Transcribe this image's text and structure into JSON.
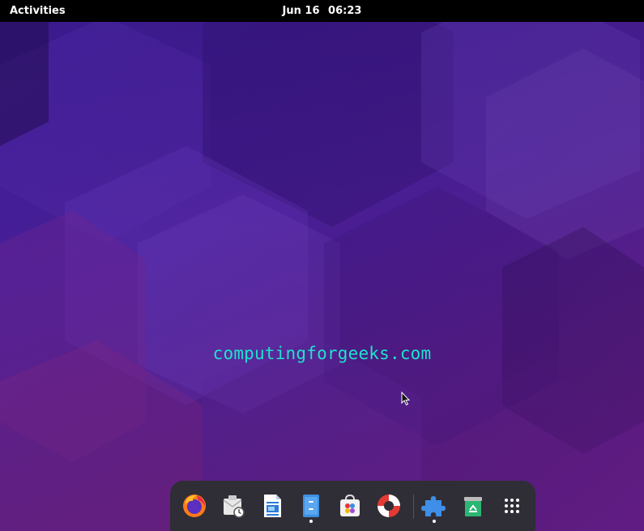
{
  "topbar": {
    "activities_label": "Activities",
    "date": "Jun 16",
    "time": "06:23"
  },
  "desktop": {
    "watermark": "computingforgeeks.com"
  },
  "dock": {
    "apps": [
      {
        "icon": "firefox-icon",
        "running": false
      },
      {
        "icon": "evolution-mail-icon",
        "running": false
      },
      {
        "icon": "libreoffice-writer-icon",
        "running": false
      },
      {
        "icon": "files-icon",
        "running": true
      },
      {
        "icon": "software-store-icon",
        "running": false
      },
      {
        "icon": "help-lifebuoy-icon",
        "running": false
      },
      {
        "icon": "extensions-puzzle-icon",
        "running": true
      },
      {
        "icon": "trash-icon",
        "running": false
      },
      {
        "icon": "app-grid-icon",
        "running": false
      }
    ]
  },
  "colors": {
    "topbar_bg": "#000000",
    "dock_bg": "#2f2e36",
    "watermark": "#1ee3cf",
    "wallpaper_base": "#4b1fa0"
  }
}
